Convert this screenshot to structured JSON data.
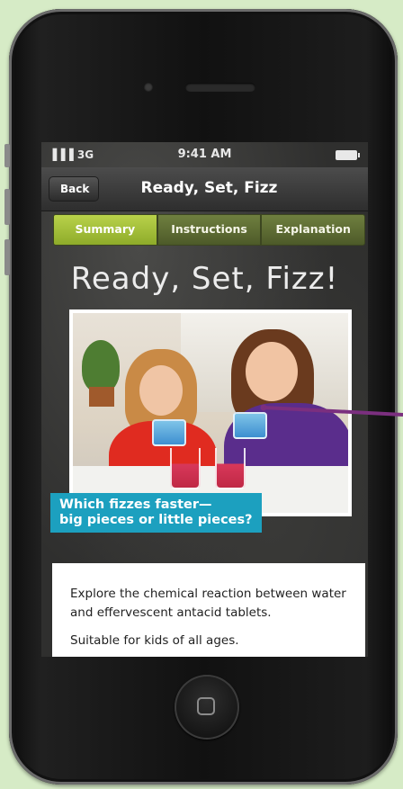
{
  "colors": {
    "background": "#d6ebc6",
    "tab_active": "#a6c238",
    "tab_inactive": "#5b6832",
    "caption_bg": "#1ca0bf",
    "callout_line": "#7b2f7f"
  },
  "status_bar": {
    "signal": "▐▐▐ 3G",
    "time": "9:41 AM",
    "battery_icon": "battery-icon"
  },
  "nav_bar": {
    "back_label": "Back",
    "title": "Ready, Set, Fizz"
  },
  "tabs": [
    {
      "label": "Summary",
      "active": true
    },
    {
      "label": "Instructions",
      "active": false
    },
    {
      "label": "Explanation",
      "active": false
    }
  ],
  "content": {
    "heading": "Ready, Set, Fizz!",
    "photo_caption": "Which fizzes faster—\nbig pieces or little pieces?",
    "description_lines": [
      "Explore the chemical reaction between water and effervescent antacid tablets.",
      "Suitable for kids of all ages."
    ]
  },
  "icons": {
    "home_button": "home-square-icon"
  }
}
